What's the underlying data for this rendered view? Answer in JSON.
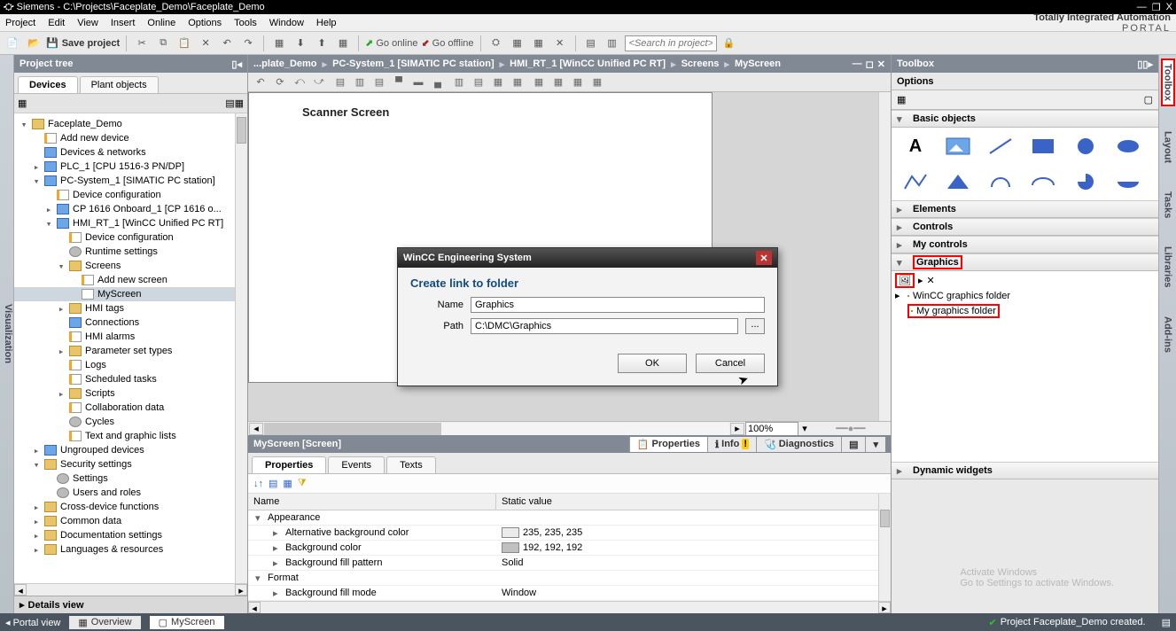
{
  "window": {
    "title": "Siemens  -  C:\\Projects\\Faceplate_Demo\\Faceplate_Demo",
    "min": "—",
    "restore": "❐",
    "close": "X"
  },
  "menu": {
    "items": [
      "Project",
      "Edit",
      "View",
      "Insert",
      "Online",
      "Options",
      "Tools",
      "Window",
      "Help"
    ],
    "brand_line1": "Totally Integrated Automation",
    "brand_line2": "PORTAL"
  },
  "toolbar": {
    "save_label": "Save project",
    "go_online": "Go online",
    "go_offline": "Go offline",
    "search_placeholder": "<Search in project>"
  },
  "left_rail": {
    "label": "Visualization"
  },
  "project_tree": {
    "title": "Project tree",
    "tabs": {
      "devices": "Devices",
      "plant": "Plant objects"
    },
    "nodes": [
      {
        "d": 0,
        "exp": "▾",
        "ic": "ic-folder",
        "label": "Faceplate_Demo"
      },
      {
        "d": 1,
        "exp": "",
        "ic": "ic-page",
        "label": "Add new device"
      },
      {
        "d": 1,
        "exp": "",
        "ic": "ic-device",
        "label": "Devices & networks"
      },
      {
        "d": 1,
        "exp": "▸",
        "ic": "ic-device",
        "label": "PLC_1 [CPU 1516-3 PN/DP]"
      },
      {
        "d": 1,
        "exp": "▾",
        "ic": "ic-device",
        "label": "PC-System_1 [SIMATIC PC station]"
      },
      {
        "d": 2,
        "exp": "",
        "ic": "ic-page",
        "label": "Device configuration"
      },
      {
        "d": 2,
        "exp": "▸",
        "ic": "ic-device",
        "label": "CP 1616 Onboard_1 [CP 1616 o..."
      },
      {
        "d": 2,
        "exp": "▾",
        "ic": "ic-device",
        "label": "HMI_RT_1 [WinCC Unified PC RT]"
      },
      {
        "d": 3,
        "exp": "",
        "ic": "ic-page",
        "label": "Device configuration"
      },
      {
        "d": 3,
        "exp": "",
        "ic": "ic-gear",
        "label": "Runtime settings"
      },
      {
        "d": 3,
        "exp": "▾",
        "ic": "ic-folder",
        "label": "Screens"
      },
      {
        "d": 4,
        "exp": "",
        "ic": "ic-page",
        "label": "Add new screen"
      },
      {
        "d": 4,
        "exp": "",
        "ic": "ic-screen",
        "label": "MyScreen",
        "sel": true
      },
      {
        "d": 3,
        "exp": "▸",
        "ic": "ic-folder",
        "label": "HMI tags"
      },
      {
        "d": 3,
        "exp": "",
        "ic": "ic-device",
        "label": "Connections"
      },
      {
        "d": 3,
        "exp": "",
        "ic": "ic-page",
        "label": "HMI alarms"
      },
      {
        "d": 3,
        "exp": "▸",
        "ic": "ic-folder",
        "label": "Parameter set types"
      },
      {
        "d": 3,
        "exp": "",
        "ic": "ic-page",
        "label": "Logs"
      },
      {
        "d": 3,
        "exp": "",
        "ic": "ic-page",
        "label": "Scheduled tasks"
      },
      {
        "d": 3,
        "exp": "▸",
        "ic": "ic-folder",
        "label": "Scripts"
      },
      {
        "d": 3,
        "exp": "",
        "ic": "ic-page",
        "label": "Collaboration data"
      },
      {
        "d": 3,
        "exp": "",
        "ic": "ic-gear",
        "label": "Cycles"
      },
      {
        "d": 3,
        "exp": "",
        "ic": "ic-page",
        "label": "Text and graphic lists"
      },
      {
        "d": 1,
        "exp": "▸",
        "ic": "ic-device",
        "label": "Ungrouped devices"
      },
      {
        "d": 1,
        "exp": "▾",
        "ic": "ic-folder",
        "label": "Security settings"
      },
      {
        "d": 2,
        "exp": "",
        "ic": "ic-gear",
        "label": "Settings"
      },
      {
        "d": 2,
        "exp": "",
        "ic": "ic-gear",
        "label": "Users and roles"
      },
      {
        "d": 1,
        "exp": "▸",
        "ic": "ic-folder",
        "label": "Cross-device functions"
      },
      {
        "d": 1,
        "exp": "▸",
        "ic": "ic-folder",
        "label": "Common data"
      },
      {
        "d": 1,
        "exp": "▸",
        "ic": "ic-folder",
        "label": "Documentation settings"
      },
      {
        "d": 1,
        "exp": "▸",
        "ic": "ic-folder",
        "label": "Languages & resources"
      }
    ],
    "details_title": "Details view"
  },
  "breadcrumb": {
    "items": [
      "...plate_Demo",
      "PC-System_1 [SIMATIC PC station]",
      "HMI_RT_1 [WinCC Unified PC RT]",
      "Screens",
      "MyScreen"
    ]
  },
  "canvas": {
    "screen_title": "Scanner Screen",
    "zoom": "100%"
  },
  "inspector": {
    "title": "MyScreen [Screen]",
    "right_tabs": {
      "properties": "Properties",
      "info": "Info",
      "diagnostics": "Diagnostics"
    },
    "sub_tabs": {
      "properties": "Properties",
      "events": "Events",
      "texts": "Texts"
    },
    "columns": {
      "name": "Name",
      "static": "Static value"
    },
    "rows": [
      {
        "group": true,
        "exp": "▾",
        "label": "Appearance"
      },
      {
        "exp": "▸",
        "label": "Alternative background color",
        "swatch": "#ebebeb",
        "value": "235, 235, 235"
      },
      {
        "exp": "▸",
        "label": "Background color",
        "swatch": "#c0c0c0",
        "value": "192, 192, 192"
      },
      {
        "exp": "▸",
        "label": "Background fill pattern",
        "value": "Solid"
      },
      {
        "group": true,
        "exp": "▾",
        "label": "Format"
      },
      {
        "exp": "▸",
        "label": "Background fill mode",
        "value": "Window"
      }
    ]
  },
  "toolbox": {
    "title": "Toolbox",
    "options": "Options",
    "sections": {
      "basic": "Basic objects",
      "elements": "Elements",
      "controls": "Controls",
      "mycontrols": "My controls",
      "graphics": "Graphics",
      "dynamic": "Dynamic widgets"
    },
    "graphics": {
      "folder_wincc": "WinCC graphics folder",
      "folder_my": "My graphics folder",
      "expander": "▸",
      "close_x": "✕"
    }
  },
  "right_rail": {
    "tabs": [
      "Toolbox",
      "Layout",
      "Tasks",
      "Libraries",
      "Add-ins"
    ]
  },
  "dialog": {
    "title": "WinCC Engineering System",
    "heading": "Create link to folder",
    "name_label": "Name",
    "name_value": "Graphics",
    "path_label": "Path",
    "path_value": "C:\\DMC\\Graphics",
    "browse": "...",
    "ok": "OK",
    "cancel": "Cancel"
  },
  "statusbar": {
    "portal": "Portal view",
    "overview": "Overview",
    "myscreen": "MyScreen",
    "message": "Project Faceplate_Demo created."
  },
  "watermark": {
    "line1": "Activate Windows",
    "line2": "Go to Settings to activate Windows."
  }
}
